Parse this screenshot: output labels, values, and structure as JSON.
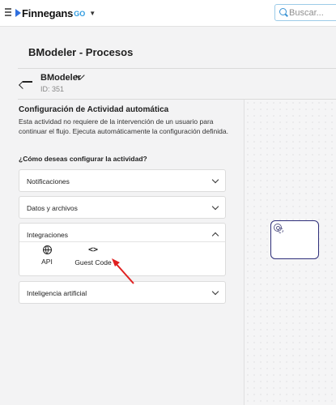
{
  "topbar": {
    "logo_text": "Finnegans",
    "logo_suffix": "GO",
    "search_placeholder": "Buscar..."
  },
  "header": {
    "title": "BModeler - Procesos",
    "process_name": "BModeler",
    "process_id": "ID: 351"
  },
  "panel": {
    "title": "Configuración de Actividad automática",
    "description": "Esta actividad no requiere de la intervención de un usuario para continuar el flujo. Ejecuta automáticamente la configuración definida.",
    "question": "¿Cómo deseas configurar la actividad?",
    "sections": [
      {
        "label": "Notificaciones",
        "expanded": false
      },
      {
        "label": "Datos y archivos",
        "expanded": false
      },
      {
        "label": "Integraciones",
        "expanded": true,
        "options": [
          {
            "label": "API",
            "icon": "globe-icon"
          },
          {
            "label": "Guest Code",
            "icon": "code-icon"
          }
        ]
      },
      {
        "label": "Inteligencia artificial",
        "expanded": false
      }
    ]
  },
  "colors": {
    "accent": "#2f6fde",
    "task_border": "#2f2f7a",
    "annotation_arrow": "#e02020"
  }
}
